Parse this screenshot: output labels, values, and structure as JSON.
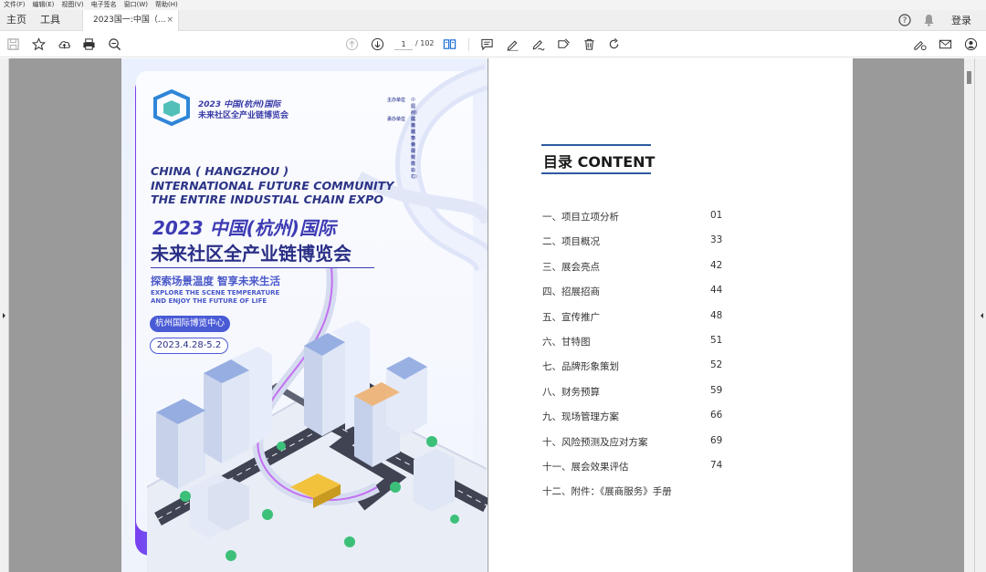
{
  "menu": [
    "文件(F)",
    "编辑(E)",
    "视图(V)",
    "电子签名",
    "窗口(W)",
    "帮助(H)"
  ],
  "nav": {
    "home": "主页",
    "tools": "工具"
  },
  "tab": {
    "title": "2023国一:中国（...",
    "close": "×"
  },
  "login": "登录",
  "page": {
    "current": "1",
    "total": "/ 102"
  },
  "cover": {
    "logo_line1": "2023 中国(杭州)国际",
    "logo_line2": "未来社区全产业链博览会",
    "org_labels": [
      "主办单位",
      "承办单位"
    ],
    "org_text": [
      "中国社区发展协会",
      "杭州国际城市学研究中心",
      "(浙江省城市治理研究中心)",
      "杭州雅舍会展有限公司"
    ],
    "en_title": [
      "CHINA ( HANGZHOU )",
      "INTERNATIONAL FUTURE COMMUNITY",
      "THE ENTIRE INDUSTIAL CHAIN EXPO"
    ],
    "cn_title1": "2023 中国(杭州)国际",
    "cn_title2": "未来社区全产业链博览会",
    "slogan": "探索场景温度  智享未来生活",
    "slogan_en": [
      "EXPLORE THE SCENE TEMPERATURE",
      "AND ENJOY THE FUTURE OF LIFE"
    ],
    "venue": "杭州国际博览中心",
    "date": "2023.4.28-5.2"
  },
  "toc": {
    "title": "目录 CONTENT",
    "items": [
      {
        "label": "一、项目立项分析",
        "page": "01"
      },
      {
        "label": "二、项目概况",
        "page": "33"
      },
      {
        "label": "三、展会亮点",
        "page": "42"
      },
      {
        "label": "四、招展招商",
        "page": "44"
      },
      {
        "label": "五、宣传推广",
        "page": "48"
      },
      {
        "label": "六、甘特图",
        "page": "51"
      },
      {
        "label": "七、品牌形象策划",
        "page": "52"
      },
      {
        "label": "八、财务预算",
        "page": "59"
      },
      {
        "label": "九、现场管理方案",
        "page": "66"
      },
      {
        "label": "十、风险预测及应对方案",
        "page": "69"
      },
      {
        "label": "十一、展会效果评估",
        "page": "74"
      },
      {
        "label": "十二、附件：《展商服务》手册",
        "page": ""
      }
    ]
  },
  "icons": {
    "help": "help-icon",
    "bell": "bell-icon"
  }
}
